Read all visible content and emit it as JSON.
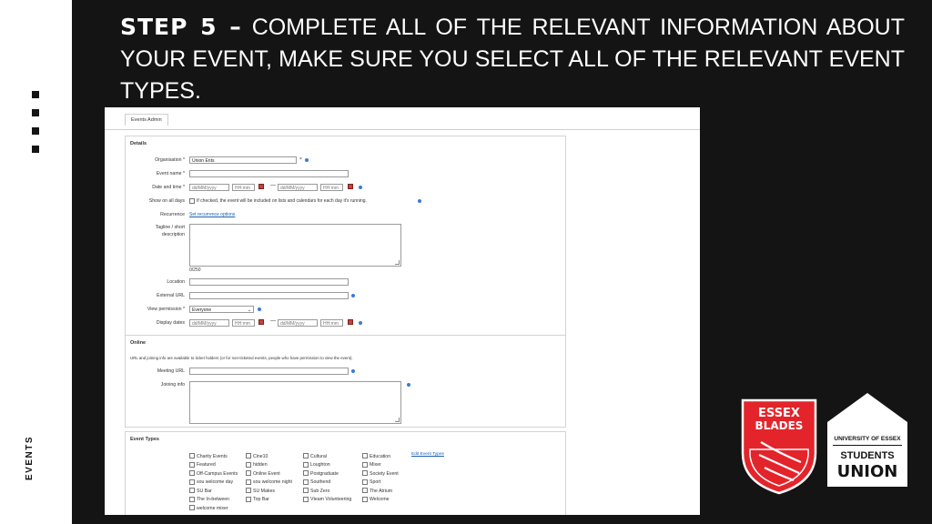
{
  "slide": {
    "heading_step": "STEP 5 –",
    "heading_text": " COMPLETE ALL OF THE RELEVANT INFORMATION ABOUT YOUR EVENT, MAKE SURE YOU SELECT ALL OF THE RELEVANT EVENT TYPES.",
    "side_label": "EVENTS",
    "colors": {
      "background": "#141414",
      "text": "#ffffff",
      "red": "#e3242b"
    }
  },
  "screenshot": {
    "tab_label": "Events Admin",
    "details": {
      "title": "Details",
      "organisation_label": "Organisation *",
      "organisation_value": "Union Ents",
      "event_name_label": "Event name *",
      "date_time_label": "Date and time *",
      "date_placeholder": "dd/MM/yyyy",
      "time_placeholder": "HH:mm",
      "show_all_days_label": "Show on all days",
      "show_all_days_note": "If checked, the event will be included on lists and calendars for each day it's running.",
      "recurrence_label": "Recurrence",
      "recurrence_link": "Set recurrence options",
      "tagline_label_1": "Tagline / short",
      "tagline_label_2": "description",
      "char_count": "0/250",
      "location_label": "Location",
      "external_url_label": "External URL",
      "view_permission_label": "View permission *",
      "view_permission_value": "Everyone",
      "display_dates_label": "Display dates"
    },
    "online": {
      "title": "Online",
      "note": "URL and joining info are available to ticket holders (or for non-ticketed events, people who have permission to view the event).",
      "meeting_url_label": "Meeting URL",
      "joining_info_label": "Joining info"
    },
    "event_types": {
      "title": "Event Types",
      "edit_link": "Edit Event Types",
      "columns": [
        [
          "Charity Events",
          "Featured",
          "Off-Campus Events",
          "sou welcome day",
          "SU Bar",
          "The In-between",
          "welcome mixer"
        ],
        [
          "Cine10",
          "hidden",
          "Online Event",
          "sou welcome night",
          "SU Makes",
          "Top Bar"
        ],
        [
          "Cultural",
          "Loughton",
          "Postgraduate",
          "Southend",
          "Sub Zero",
          "Vteam Volunteering"
        ],
        [
          "Education",
          "Mixer",
          "Society Event",
          "Sport",
          "The Atrium",
          "Welcome"
        ]
      ]
    }
  },
  "logos": {
    "blades_line1": "ESSEX",
    "blades_line2": "BLADES",
    "su_line1": "UNIVERSITY OF ESSEX",
    "su_line2": "STUDENTS",
    "su_line3": "UNION"
  }
}
